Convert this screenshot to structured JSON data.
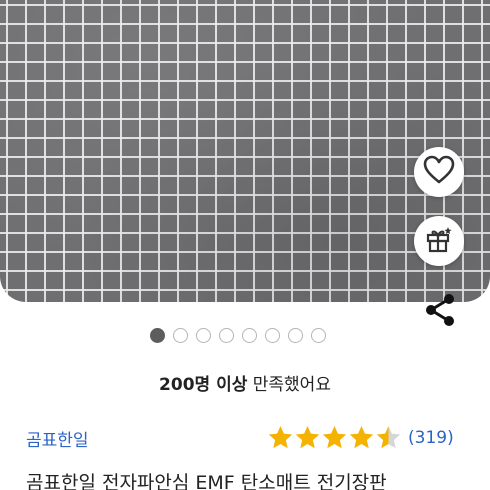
{
  "product": {
    "image_alt": "grid-patterned gray electric mat photo",
    "dots_total": 8,
    "dots_active_index": 0,
    "satisfaction_bold": "200명 이상",
    "satisfaction_rest": " 만족했어요",
    "brand": "곰표한일",
    "rating": 4.5,
    "review_count": "(319)",
    "title": "곰표한일 전자파안심 EMF 탄소매트 전기장판"
  },
  "icons": {
    "wishlist": "heart-icon",
    "gift": "gift-icon",
    "share": "share-icon",
    "star": "star-icon"
  },
  "colors": {
    "star": "#f5b301",
    "star_empty": "#d6d6d6",
    "link": "#2c64c4",
    "active_dot": "#5d5d5d"
  }
}
